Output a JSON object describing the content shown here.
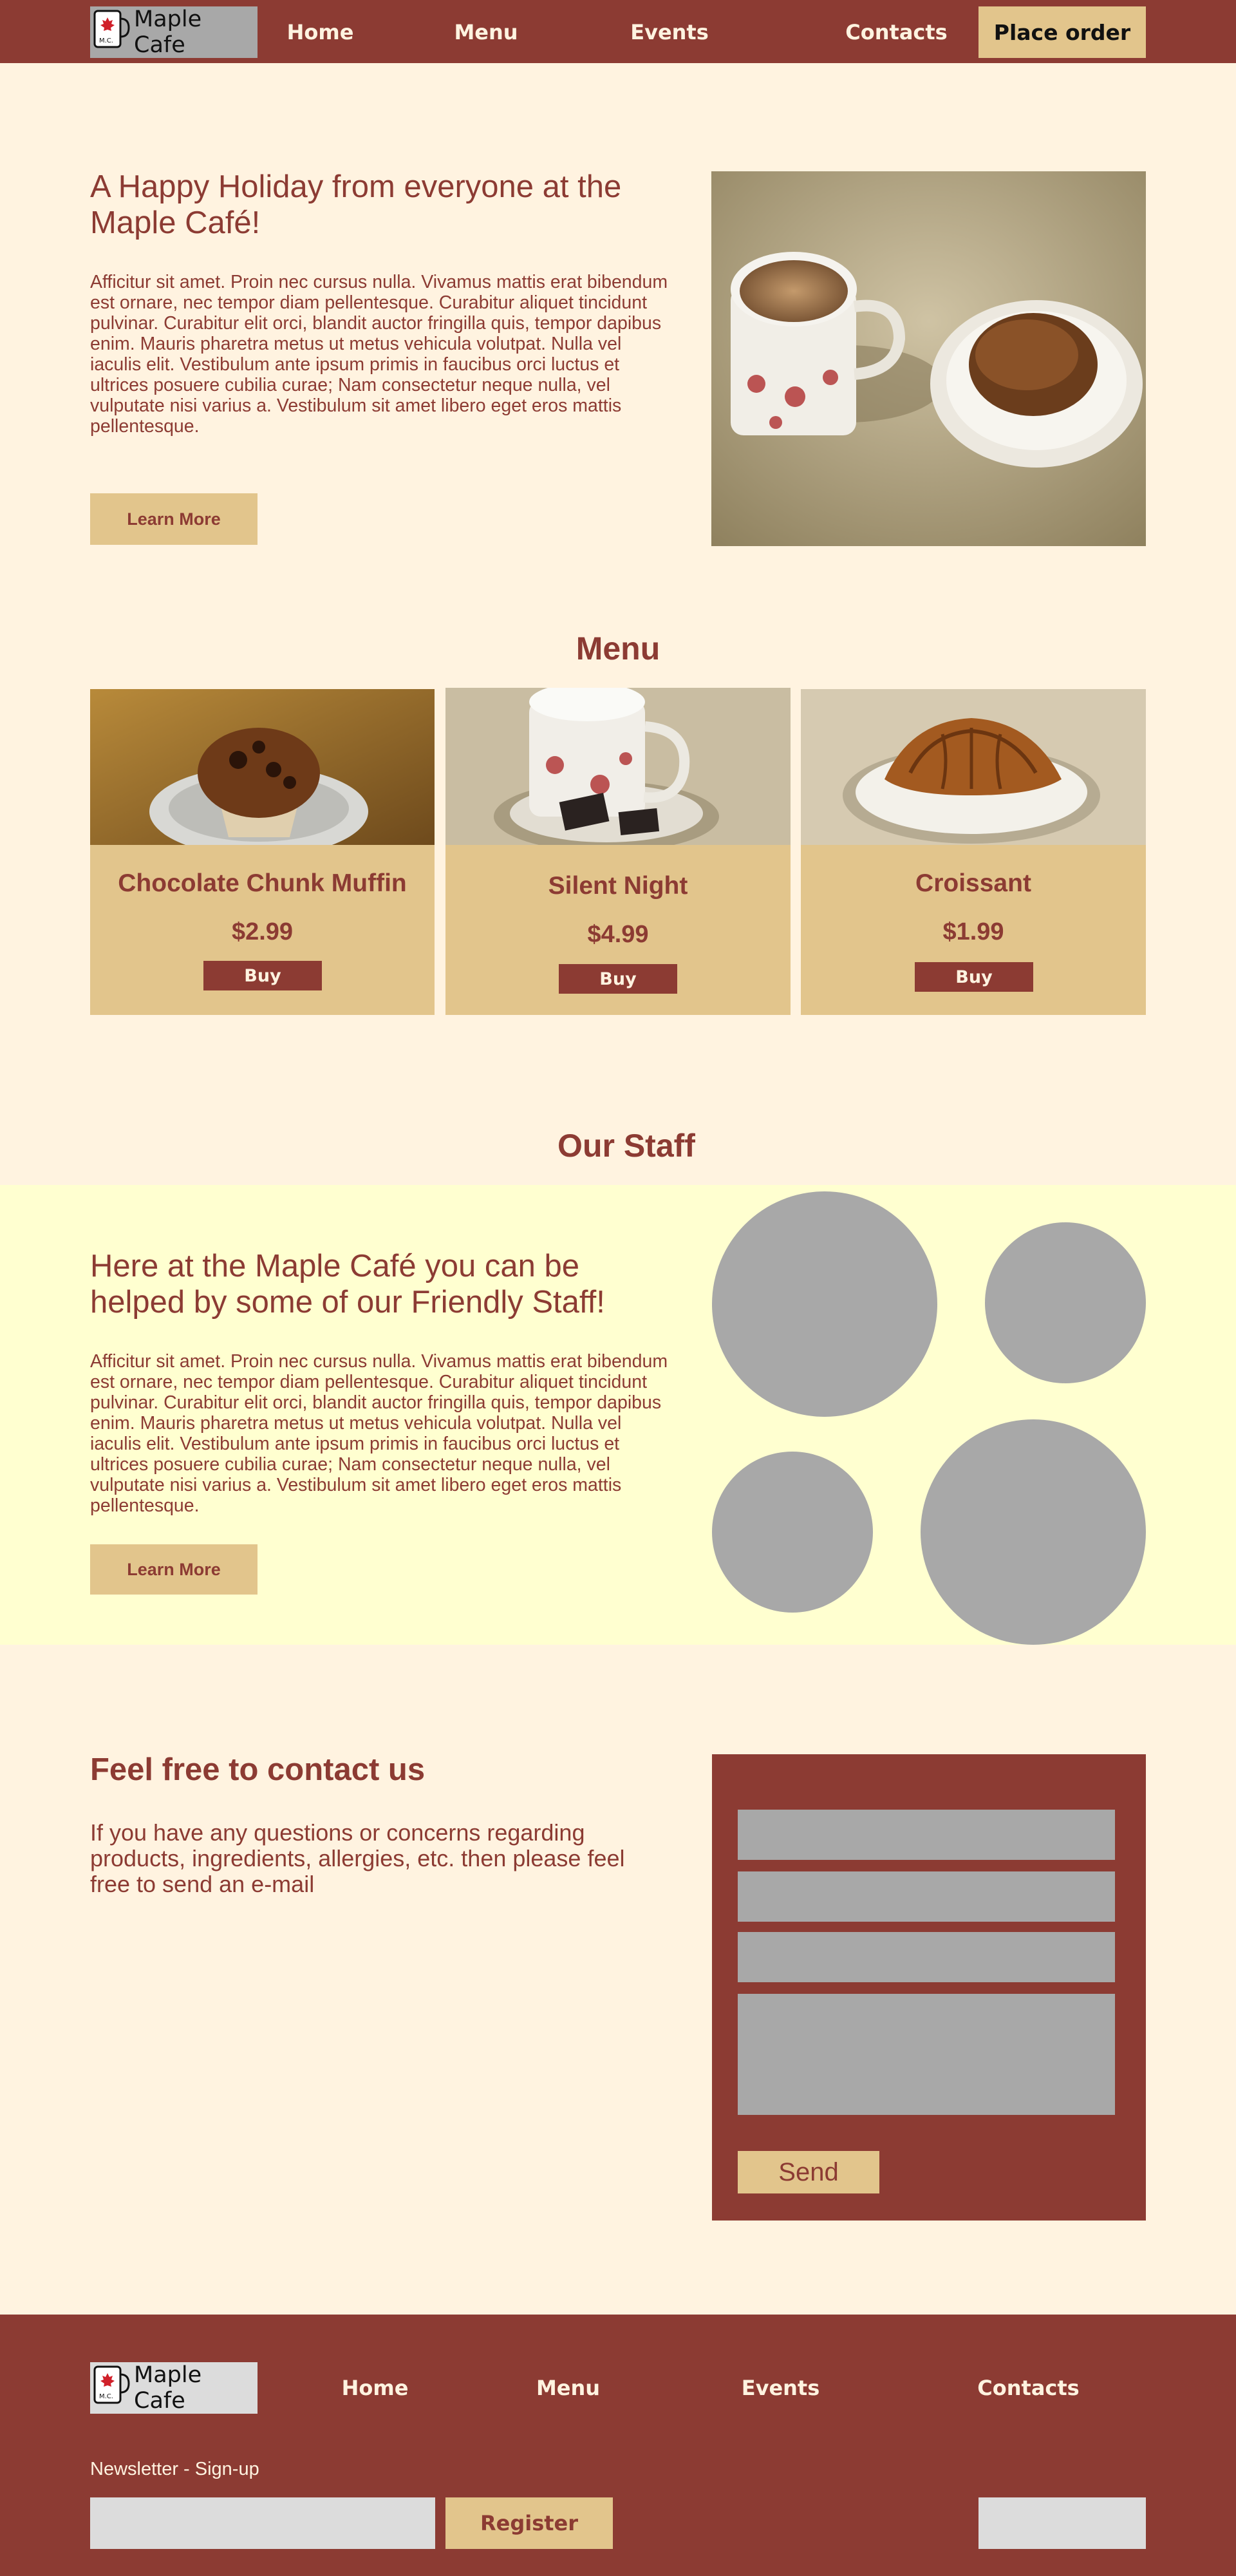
{
  "nav": {
    "logo_text": "Maple Cafe",
    "mug_label": "M.C.",
    "links": [
      "Home",
      "Menu",
      "Events",
      "Contacts"
    ],
    "cta_label": "Place order"
  },
  "hero": {
    "heading": "A Happy Holiday from everyone at the Maple Café!",
    "body": "Afficitur sit amet. Proin nec cursus nulla. Vivamus mattis erat bibendum est ornare, nec tempor diam pellentesque. Curabitur aliquet tincidunt pulvinar. Curabitur elit orci, blandit auctor fringilla quis, tempor dapibus enim. Mauris pharetra metus ut metus vehicula volutpat. Nulla vel iaculis elit. Vestibulum ante ipsum primis in faucibus orci luctus et ultrices posuere cubilia curae; Nam consectetur neque nulla, vel vulputate nisi varius a. Vestibulum sit amet libero eget eros mattis pellentesque.",
    "button_label": "Learn More"
  },
  "menu": {
    "title": "Menu",
    "items": [
      {
        "name": "Chocolate Chunk Muffin",
        "price": "$2.99",
        "buy_label": "Buy"
      },
      {
        "name": "Silent Night",
        "price": "$4.99",
        "buy_label": "Buy"
      },
      {
        "name": "Croissant",
        "price": "$1.99",
        "buy_label": "Buy"
      }
    ]
  },
  "staff": {
    "title": "Our Staff",
    "heading": "Here at the Maple Café you can be helped by some of our Friendly Staff!",
    "body": "Afficitur sit amet. Proin nec cursus nulla. Vivamus mattis erat bibendum est ornare, nec tempor diam pellentesque. Curabitur aliquet tincidunt pulvinar. Curabitur elit orci, blandit auctor fringilla quis, tempor dapibus enim. Mauris pharetra metus ut metus vehicula volutpat. Nulla vel iaculis elit. Vestibulum ante ipsum primis in faucibus orci luctus et ultrices posuere cubilia curae; Nam consectetur neque nulla, vel vulputate nisi varius a. Vestibulum sit amet libero eget eros mattis pellentesque.",
    "button_label": "Learn More"
  },
  "contact": {
    "heading": "Feel free to contact us",
    "body": "If you have any questions or concerns regarding products, ingredients, allergies, etc. then please feel free to send an e-mail",
    "send_label": "Send"
  },
  "footer": {
    "logo_text": "Maple Cafe",
    "mug_label": "M.C.",
    "links": [
      "Home",
      "Menu",
      "Events",
      "Contacts"
    ],
    "newsletter_label": "Newsletter - Sign-up",
    "register_label": "Register"
  },
  "colors": {
    "brand": "#8c3b33",
    "cream": "#fff3e0",
    "tan": "#e2c58c",
    "staff_band": "#ffffd0",
    "placeholder": "#a8a8a8"
  }
}
